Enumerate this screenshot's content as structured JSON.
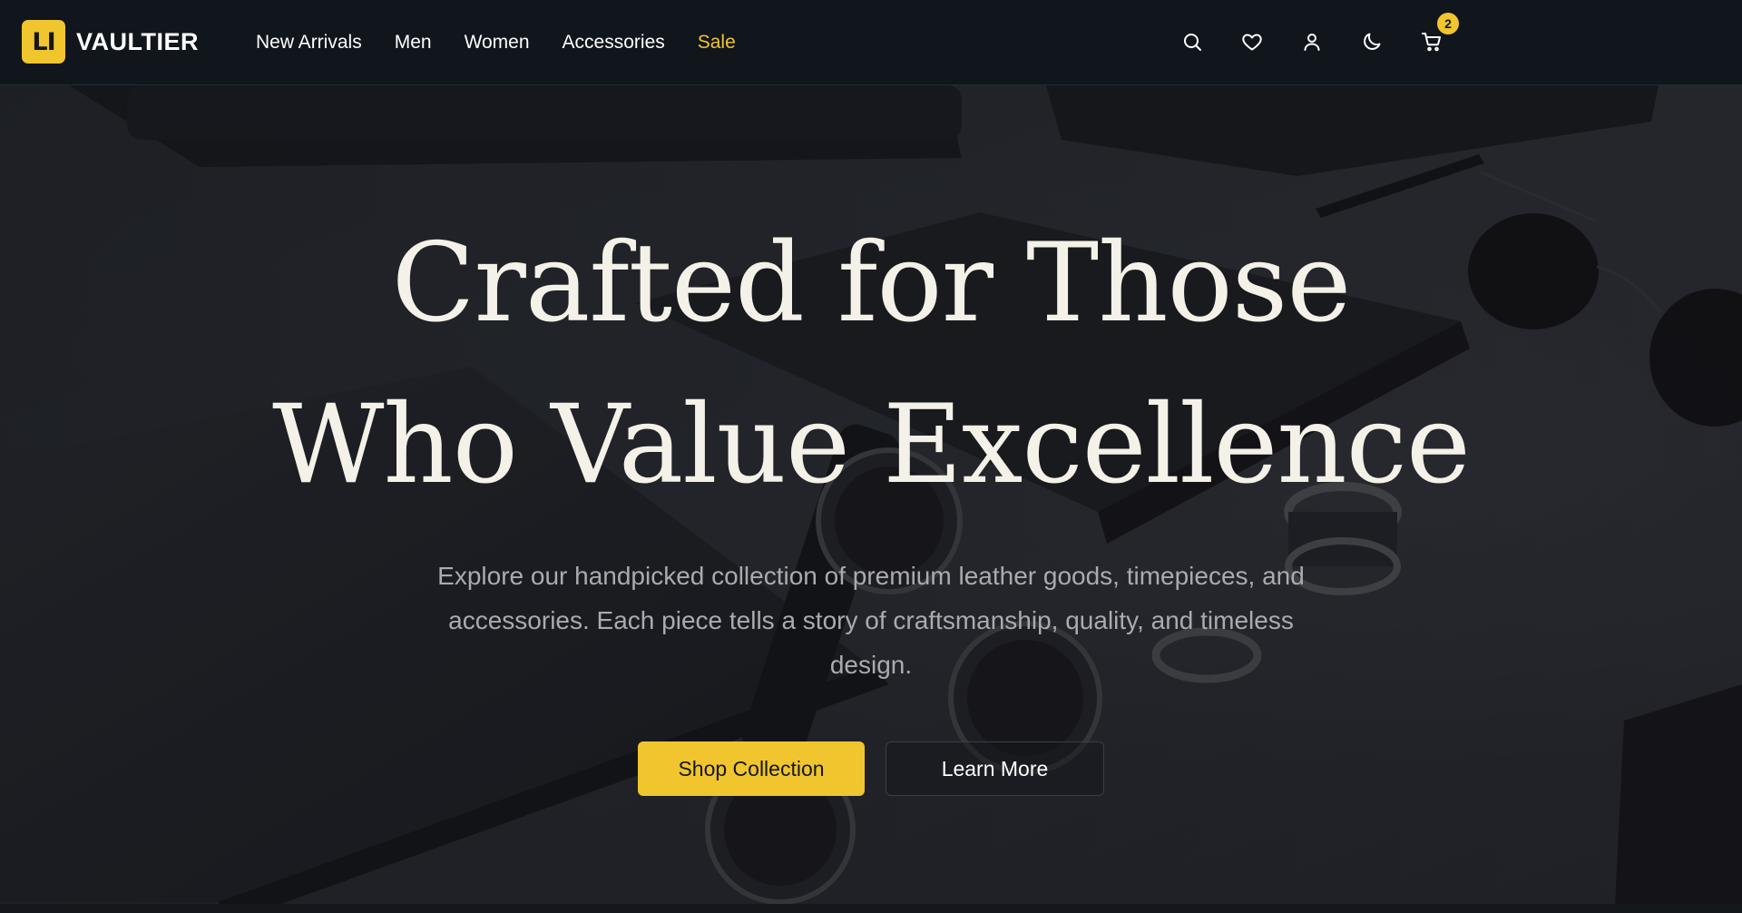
{
  "brand": {
    "logo_text": "LI",
    "name": "VAULTIER"
  },
  "nav": {
    "links": [
      {
        "label": "New Arrivals"
      },
      {
        "label": "Men"
      },
      {
        "label": "Women"
      },
      {
        "label": "Accessories"
      },
      {
        "label": "Sale"
      }
    ]
  },
  "header_icons": [
    {
      "icon": "search-icon"
    },
    {
      "icon": "heart-icon"
    },
    {
      "icon": "user-icon"
    },
    {
      "icon": "moon-icon"
    },
    {
      "icon": "cart-icon"
    }
  ],
  "cart": {
    "count": "2"
  },
  "hero": {
    "title_line1": "Crafted for Those",
    "title_line2": "Who Value Excellence",
    "subtitle": "Explore our handpicked collection of premium leather goods, timepieces, and accessories. Each piece tells a story of craftsmanship, quality, and timeless design.",
    "primary_cta": "Shop Collection",
    "secondary_cta": "Learn More"
  },
  "colors": {
    "accent": "#f0c52e",
    "nav_background": "#11151c",
    "hero_text": "#f4f1e8",
    "subtitle_text": "#a9abaf"
  }
}
